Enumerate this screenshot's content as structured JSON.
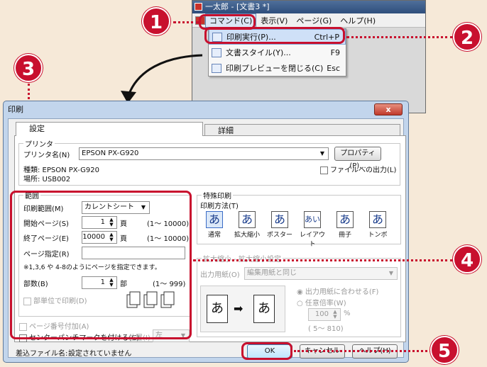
{
  "app": {
    "title": "一太郎 - [文書3 *]",
    "menus": [
      "コマンド(C)",
      "表示(V)",
      "ページ(G)",
      "ヘルプ(H)"
    ],
    "dropdown": [
      {
        "label": "印刷実行(P)...",
        "shortcut": "Ctrl+P"
      },
      {
        "label": "文書スタイル(Y)...",
        "shortcut": "F9"
      },
      {
        "label": "印刷プレビューを閉じる(C)",
        "shortcut": "Esc"
      }
    ]
  },
  "callouts": [
    "1",
    "2",
    "3",
    "4",
    "5"
  ],
  "dialog": {
    "title": "印刷",
    "close": "x",
    "tabs": [
      "設定",
      "詳細"
    ],
    "printer": {
      "group": "プリンタ",
      "name_label": "プリンタ名(N)",
      "name_value": "EPSON PX-G920",
      "props_button": "プロパティ(P)...",
      "type_label": "種類: EPSON PX-G920",
      "location_label": "場所: USB002",
      "print_to_file": "ファイルへの出力(L)"
    },
    "range": {
      "group": "範囲",
      "range_label": "印刷範囲(M)",
      "range_value": "カレントシート",
      "start_label": "開始ページ(S)",
      "start_value": "1",
      "start_unit": "頁",
      "start_hint": "(1～ 10000)",
      "end_label": "終了ページ(E)",
      "end_value": "10000",
      "end_unit": "頁",
      "end_hint": "(1～ 10000)",
      "pages_label": "ページ指定(R)",
      "pages_hint": "※1,3,6 や 4-8のようにページを指定できます。",
      "copies_label": "部数(B)",
      "copies_value": "1",
      "copies_unit": "部",
      "copies_hint": "(1～ 999)",
      "collate_label": "部単位で印刷(D)"
    },
    "special": {
      "group": "特殊印刷",
      "method_label": "印刷方法(T)",
      "modes": [
        {
          "glyph": "あ",
          "label": "通常"
        },
        {
          "glyph": "あ",
          "label": "拡大縮小"
        },
        {
          "glyph": "あ",
          "label": "ポスター"
        },
        {
          "glyph": "あい",
          "label": "レイアウト"
        },
        {
          "glyph": "あ",
          "label": "冊子"
        },
        {
          "glyph": "あ",
          "label": "トンボ"
        }
      ],
      "scale_group": "拡大縮小 - 拡大縮小設定",
      "paper_label": "出力用紙(O)",
      "paper_value": "編集用紙と同じ",
      "fit_label": "出力用紙に合わせる(F)",
      "ratio_label": "任意倍率(W)",
      "ratio_value": "100",
      "ratio_unit": "%",
      "ratio_hint": "( 5～ 810)",
      "preview_glyph": "あ",
      "preview_arrow": "➡"
    },
    "page_number": "ページ番号付加(A)",
    "center_mark": "センターパンチマークを付ける(C)",
    "position_label": "位置(I)",
    "position_value": "左",
    "merge_label": "差込ファイル名:",
    "merge_value": "設定されていません",
    "ok": "OK",
    "cancel": "キャンセル",
    "help": "ヘルプ(H)"
  }
}
